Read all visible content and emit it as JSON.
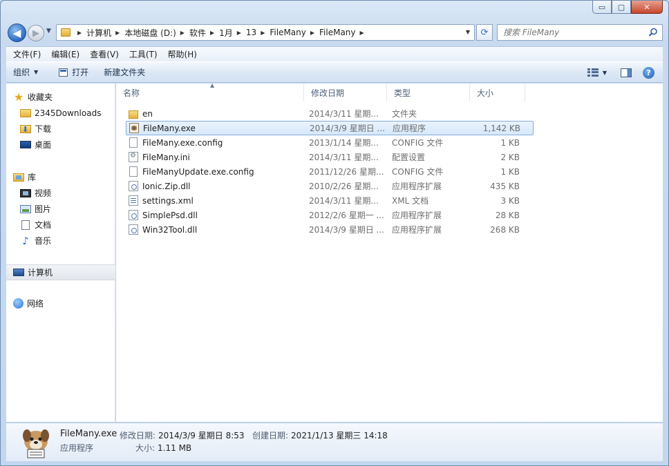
{
  "window": {
    "caption_buttons": {
      "minimize": "▭",
      "maximize": "▢",
      "close": "✕"
    }
  },
  "address": {
    "breadcrumbs": [
      "计算机",
      "本地磁盘 (D:)",
      "软件",
      "1月",
      "13",
      "FileMany",
      "FileMany"
    ],
    "search_placeholder": "搜索 FileMany"
  },
  "menubar": {
    "items": [
      "文件(F)",
      "编辑(E)",
      "查看(V)",
      "工具(T)",
      "帮助(H)"
    ]
  },
  "toolbar": {
    "organize_label": "组织",
    "open_label": "打开",
    "new_folder_label": "新建文件夹",
    "help_glyph": "?"
  },
  "nav": {
    "favorites": {
      "label": "收藏夹",
      "items": [
        "2345Downloads",
        "下载",
        "桌面"
      ]
    },
    "libraries": {
      "label": "库",
      "items": [
        "视频",
        "图片",
        "文档",
        "音乐"
      ]
    },
    "computer": "计算机",
    "network": "网络"
  },
  "columns": [
    "名称",
    "修改日期",
    "类型",
    "大小"
  ],
  "files": [
    {
      "name": "en",
      "date": "2014/3/11 星期...",
      "type": "文件夹",
      "size": "",
      "icon": "folder"
    },
    {
      "name": "FileMany.exe",
      "date": "2014/3/9 星期日 ...",
      "type": "应用程序",
      "size": "1,142 KB",
      "icon": "exe"
    },
    {
      "name": "FileMany.exe.config",
      "date": "2013/1/14 星期...",
      "type": "CONFIG 文件",
      "size": "1 KB",
      "icon": "generic"
    },
    {
      "name": "FileMany.ini",
      "date": "2014/3/11 星期...",
      "type": "配置设置",
      "size": "2 KB",
      "icon": "ini"
    },
    {
      "name": "FileManyUpdate.exe.config",
      "date": "2011/12/26 星期...",
      "type": "CONFIG 文件",
      "size": "1 KB",
      "icon": "generic"
    },
    {
      "name": "Ionic.Zip.dll",
      "date": "2010/2/26 星期...",
      "type": "应用程序扩展",
      "size": "435 KB",
      "icon": "dll"
    },
    {
      "name": "settings.xml",
      "date": "2014/3/11 星期...",
      "type": "XML 文档",
      "size": "3 KB",
      "icon": "xml"
    },
    {
      "name": "SimplePsd.dll",
      "date": "2012/2/6 星期一 ...",
      "type": "应用程序扩展",
      "size": "28 KB",
      "icon": "dll"
    },
    {
      "name": "Win32Tool.dll",
      "date": "2014/3/9 星期日 ...",
      "type": "应用程序扩展",
      "size": "268 KB",
      "icon": "dll"
    }
  ],
  "selected_file_index": 1,
  "details": {
    "name": "FileMany.exe",
    "type": "应用程序",
    "modified_label": "修改日期:",
    "modified_value": "2014/3/9 星期日 8:53",
    "created_label": "创建日期:",
    "created_value": "2021/1/13 星期三 14:18",
    "size_label": "大小:",
    "size_value": "1.11 MB"
  }
}
